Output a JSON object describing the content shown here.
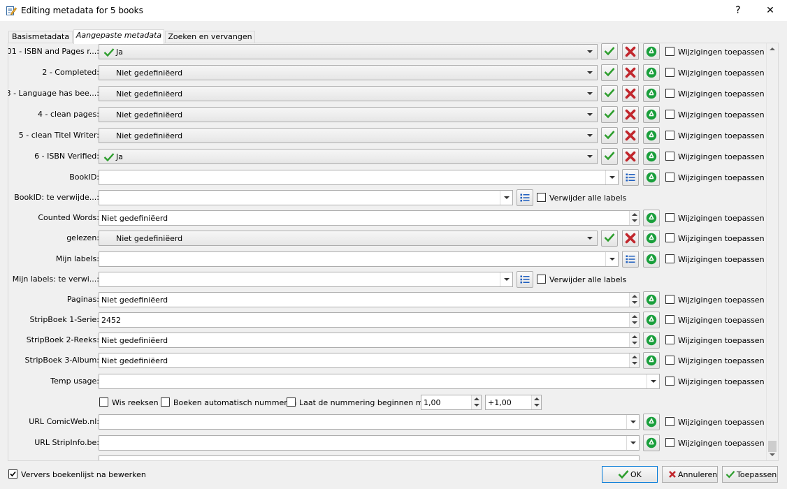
{
  "window": {
    "title": "Editing metadata for 5 books",
    "help": "?",
    "close": "✕"
  },
  "tabs": [
    "Basismetadata",
    "Aangepaste metadata",
    "Zoeken en vervangen"
  ],
  "apply_label": "Wijzigingen toepassen",
  "remove_all_label": "Verwijder alle labels",
  "rows": [
    {
      "label": "01 - ISBN and Pages r...:",
      "value": "Ja"
    },
    {
      "label": "2 - Completed:",
      "value": "Niet gedefiniëerd"
    },
    {
      "label": "3 - Language has bee...:",
      "value": "Niet gedefiniëerd"
    },
    {
      "label": "4 - clean pages:",
      "value": "Niet gedefiniëerd"
    },
    {
      "label": "5 - clean Titel Writer:",
      "value": "Niet gedefiniëerd"
    },
    {
      "label": "6 - ISBN Verified:",
      "value": "Ja"
    },
    {
      "label": "BookID:",
      "value": ""
    },
    {
      "label": "BookID: te verwijde...:",
      "value": ""
    },
    {
      "label": "Counted Words:",
      "value": "Niet gedefiniëerd"
    },
    {
      "label": "gelezen:",
      "value": "Niet gedefiniëerd"
    },
    {
      "label": "Mijn labels:",
      "value": ""
    },
    {
      "label": "Mijn labels: te verwi...:",
      "value": ""
    },
    {
      "label": "Paginas:",
      "value": "Niet gedefiniëerd"
    },
    {
      "label": "StripBoek 1-Serie:",
      "value": "2452"
    },
    {
      "label": "StripBoek 2-Reeks:",
      "value": "Niet gedefiniëerd"
    },
    {
      "label": "StripBoek 3-Album:",
      "value": "Niet gedefiniëerd"
    },
    {
      "label": "Temp usage:",
      "value": ""
    },
    {
      "label": "URL ComicWeb.nl:",
      "value": ""
    },
    {
      "label": "URL StripInfo.be:",
      "value": ""
    }
  ],
  "series_options": {
    "clear_series": "Wis reeksen",
    "auto_number": "Boeken automatisch nummeren",
    "start_numbering": "Laat de nummering beginnen met",
    "start_value": "1,00",
    "increment_value": "+1,00"
  },
  "footer": {
    "refresh_label": "Ververs boekenlijst na bewerken",
    "refresh_checked": true,
    "ok": "OK",
    "cancel": "Annuleren",
    "apply": "Toepassen"
  },
  "colors": {
    "accent": "#0078d7",
    "check_green": "#2e9e2e",
    "cross_red": "#c1272d",
    "recycle_green": "#1a9f3c"
  }
}
